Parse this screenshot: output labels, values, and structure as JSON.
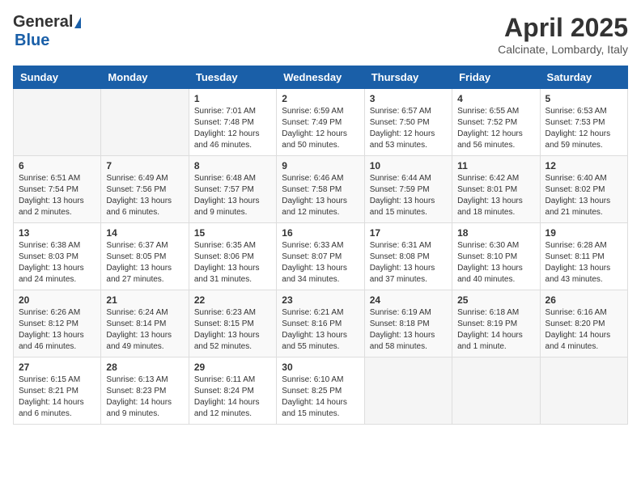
{
  "logo": {
    "general": "General",
    "blue": "Blue"
  },
  "header": {
    "month": "April 2025",
    "location": "Calcinate, Lombardy, Italy"
  },
  "weekdays": [
    "Sunday",
    "Monday",
    "Tuesday",
    "Wednesday",
    "Thursday",
    "Friday",
    "Saturday"
  ],
  "weeks": [
    [
      {
        "day": "",
        "info": ""
      },
      {
        "day": "",
        "info": ""
      },
      {
        "day": "1",
        "info": "Sunrise: 7:01 AM\nSunset: 7:48 PM\nDaylight: 12 hours and 46 minutes."
      },
      {
        "day": "2",
        "info": "Sunrise: 6:59 AM\nSunset: 7:49 PM\nDaylight: 12 hours and 50 minutes."
      },
      {
        "day": "3",
        "info": "Sunrise: 6:57 AM\nSunset: 7:50 PM\nDaylight: 12 hours and 53 minutes."
      },
      {
        "day": "4",
        "info": "Sunrise: 6:55 AM\nSunset: 7:52 PM\nDaylight: 12 hours and 56 minutes."
      },
      {
        "day": "5",
        "info": "Sunrise: 6:53 AM\nSunset: 7:53 PM\nDaylight: 12 hours and 59 minutes."
      }
    ],
    [
      {
        "day": "6",
        "info": "Sunrise: 6:51 AM\nSunset: 7:54 PM\nDaylight: 13 hours and 2 minutes."
      },
      {
        "day": "7",
        "info": "Sunrise: 6:49 AM\nSunset: 7:56 PM\nDaylight: 13 hours and 6 minutes."
      },
      {
        "day": "8",
        "info": "Sunrise: 6:48 AM\nSunset: 7:57 PM\nDaylight: 13 hours and 9 minutes."
      },
      {
        "day": "9",
        "info": "Sunrise: 6:46 AM\nSunset: 7:58 PM\nDaylight: 13 hours and 12 minutes."
      },
      {
        "day": "10",
        "info": "Sunrise: 6:44 AM\nSunset: 7:59 PM\nDaylight: 13 hours and 15 minutes."
      },
      {
        "day": "11",
        "info": "Sunrise: 6:42 AM\nSunset: 8:01 PM\nDaylight: 13 hours and 18 minutes."
      },
      {
        "day": "12",
        "info": "Sunrise: 6:40 AM\nSunset: 8:02 PM\nDaylight: 13 hours and 21 minutes."
      }
    ],
    [
      {
        "day": "13",
        "info": "Sunrise: 6:38 AM\nSunset: 8:03 PM\nDaylight: 13 hours and 24 minutes."
      },
      {
        "day": "14",
        "info": "Sunrise: 6:37 AM\nSunset: 8:05 PM\nDaylight: 13 hours and 27 minutes."
      },
      {
        "day": "15",
        "info": "Sunrise: 6:35 AM\nSunset: 8:06 PM\nDaylight: 13 hours and 31 minutes."
      },
      {
        "day": "16",
        "info": "Sunrise: 6:33 AM\nSunset: 8:07 PM\nDaylight: 13 hours and 34 minutes."
      },
      {
        "day": "17",
        "info": "Sunrise: 6:31 AM\nSunset: 8:08 PM\nDaylight: 13 hours and 37 minutes."
      },
      {
        "day": "18",
        "info": "Sunrise: 6:30 AM\nSunset: 8:10 PM\nDaylight: 13 hours and 40 minutes."
      },
      {
        "day": "19",
        "info": "Sunrise: 6:28 AM\nSunset: 8:11 PM\nDaylight: 13 hours and 43 minutes."
      }
    ],
    [
      {
        "day": "20",
        "info": "Sunrise: 6:26 AM\nSunset: 8:12 PM\nDaylight: 13 hours and 46 minutes."
      },
      {
        "day": "21",
        "info": "Sunrise: 6:24 AM\nSunset: 8:14 PM\nDaylight: 13 hours and 49 minutes."
      },
      {
        "day": "22",
        "info": "Sunrise: 6:23 AM\nSunset: 8:15 PM\nDaylight: 13 hours and 52 minutes."
      },
      {
        "day": "23",
        "info": "Sunrise: 6:21 AM\nSunset: 8:16 PM\nDaylight: 13 hours and 55 minutes."
      },
      {
        "day": "24",
        "info": "Sunrise: 6:19 AM\nSunset: 8:18 PM\nDaylight: 13 hours and 58 minutes."
      },
      {
        "day": "25",
        "info": "Sunrise: 6:18 AM\nSunset: 8:19 PM\nDaylight: 14 hours and 1 minute."
      },
      {
        "day": "26",
        "info": "Sunrise: 6:16 AM\nSunset: 8:20 PM\nDaylight: 14 hours and 4 minutes."
      }
    ],
    [
      {
        "day": "27",
        "info": "Sunrise: 6:15 AM\nSunset: 8:21 PM\nDaylight: 14 hours and 6 minutes."
      },
      {
        "day": "28",
        "info": "Sunrise: 6:13 AM\nSunset: 8:23 PM\nDaylight: 14 hours and 9 minutes."
      },
      {
        "day": "29",
        "info": "Sunrise: 6:11 AM\nSunset: 8:24 PM\nDaylight: 14 hours and 12 minutes."
      },
      {
        "day": "30",
        "info": "Sunrise: 6:10 AM\nSunset: 8:25 PM\nDaylight: 14 hours and 15 minutes."
      },
      {
        "day": "",
        "info": ""
      },
      {
        "day": "",
        "info": ""
      },
      {
        "day": "",
        "info": ""
      }
    ]
  ]
}
